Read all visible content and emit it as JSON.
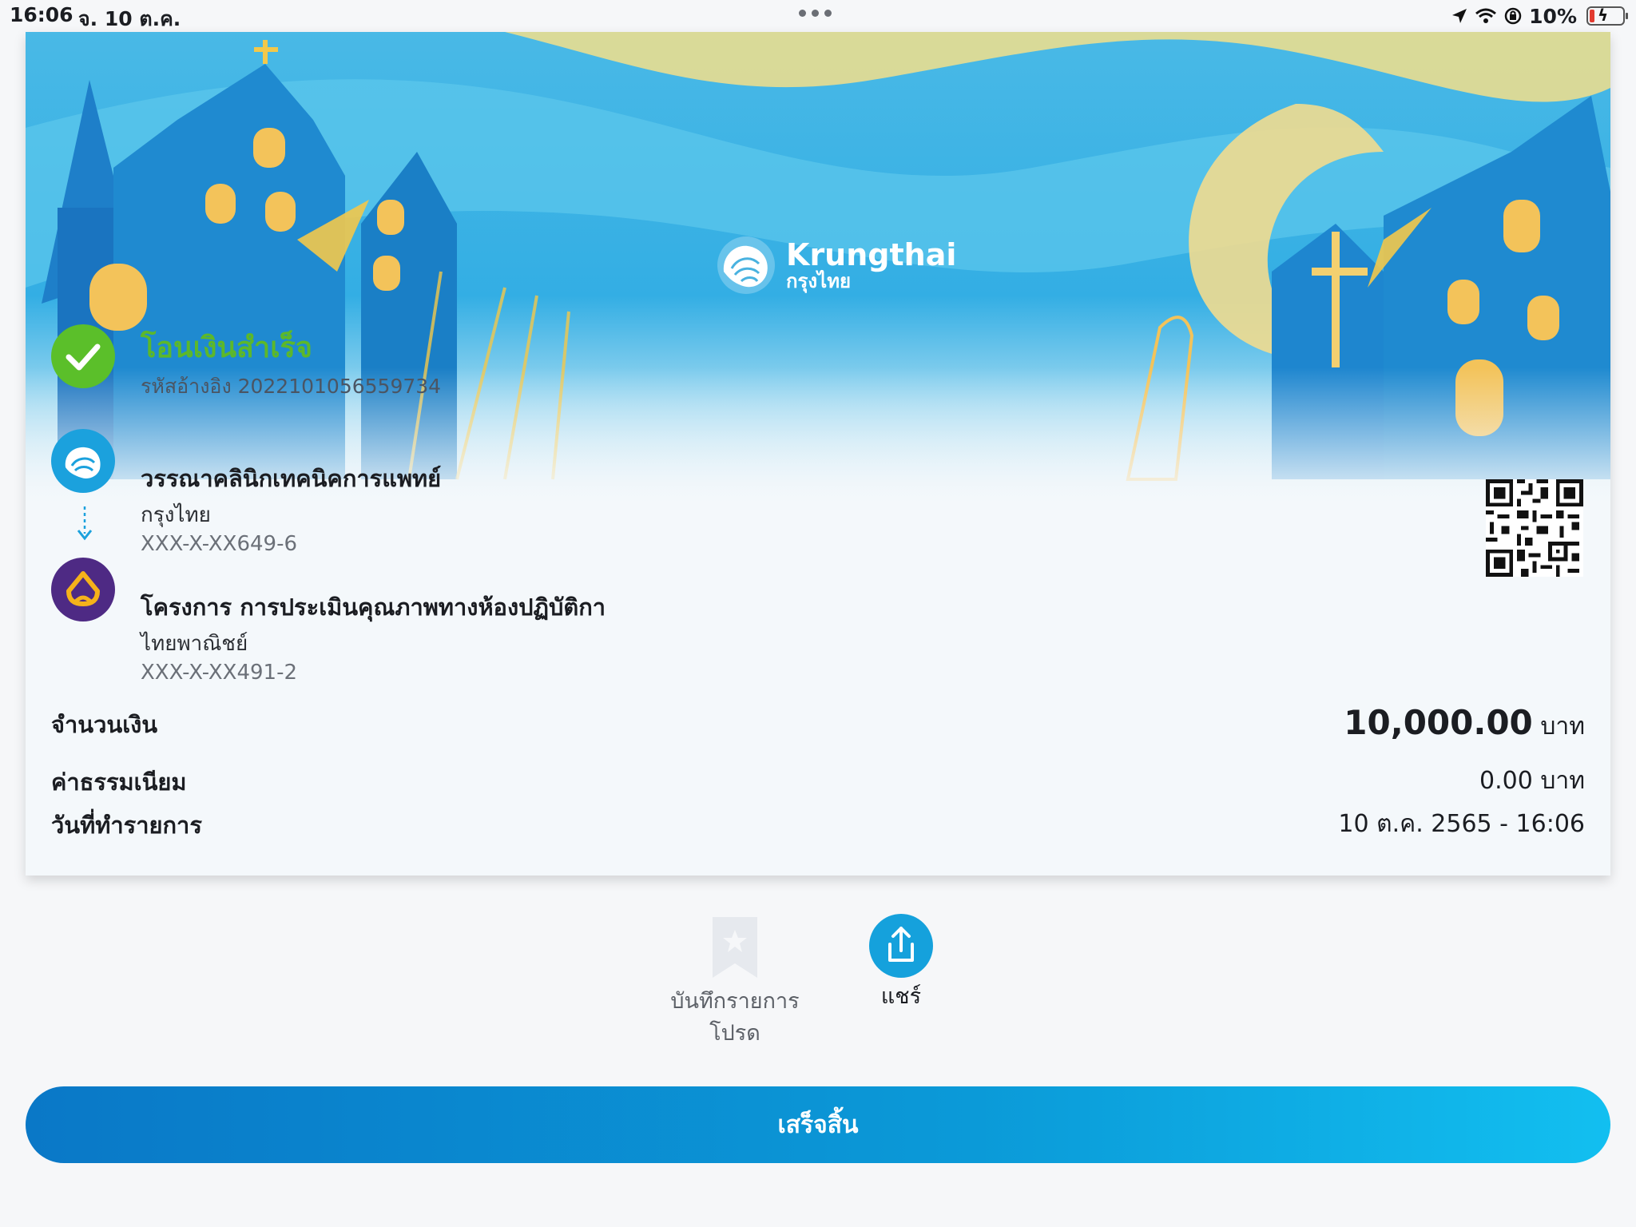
{
  "status_bar": {
    "time": "16:06",
    "date": "จ. 10 ต.ค.",
    "battery": "10%",
    "icons": [
      "location-icon",
      "wifi-icon",
      "orientation-lock-icon",
      "battery-charging-icon"
    ]
  },
  "banner": {
    "brand_en": "Krungthai",
    "brand_th": "กรุงไทย"
  },
  "result": {
    "title": "โอนเงินสำเร็จ",
    "reference": "รหัสอ้างอิง 2022101056559734",
    "status_color": "#5cb82a"
  },
  "from": {
    "name": "วรรณาคลินิกเทคนิคการแพทย์",
    "bank": "กรุงไทย",
    "account": "XXX-X-XX649-6",
    "color": "#1ba1dd"
  },
  "to": {
    "name": "โครงการ การประเมินคุณภาพทางห้องปฏิบัติกา",
    "bank": "ไทยพาณิชย์",
    "account": "XXX-X-XX491-2",
    "color": "#4e2a84"
  },
  "details": {
    "amount_label": "จำนวนเงิน",
    "amount": "10,000.00",
    "amount_unit": "บาท",
    "fee_label": "ค่าธรรมเนียม",
    "fee": "0.00 บาท",
    "date_label": "วันที่ทำรายการ",
    "date": "10 ต.ค. 2565 - 16:06"
  },
  "actions": {
    "save_favorite_line1": "บันทึกรายการ",
    "save_favorite_line2": "โปรด",
    "share": "แชร์"
  },
  "done_button": "เสร็จสิ้น",
  "accent": "#0b9ad8"
}
